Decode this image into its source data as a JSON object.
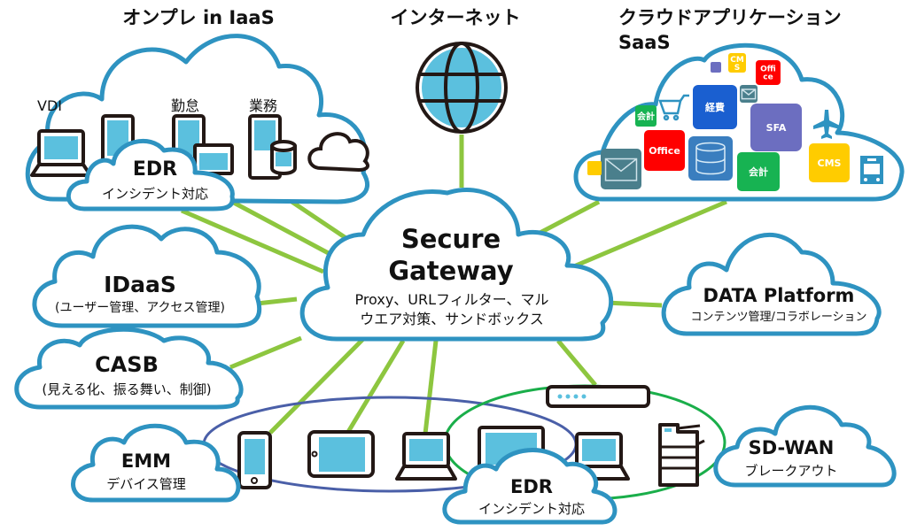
{
  "diagram": {
    "colors": {
      "cloud_stroke": "#2e93c1",
      "link": "#8dc63f",
      "emm_ring": "#4a5fa8",
      "sdwan_ring": "#1aae4a",
      "device_screen": "#5bc0de",
      "device_outline": "#231815"
    },
    "titles": {
      "iaas": "オンプレ in IaaS",
      "internet": "インターネット",
      "saas_line1": "クラウドアプリケーション",
      "saas_line2": "SaaS"
    },
    "iaas": {
      "labels": {
        "vdi": "VDI",
        "kintai": "勤怠",
        "gyomu": "業務"
      },
      "edr": {
        "title": "EDR",
        "subtitle": "インシデント対応"
      }
    },
    "saas": {
      "apps": [
        {
          "label": "",
          "color": "#6c6ec0"
        },
        {
          "label": "CM\nS",
          "line1": "CM",
          "line2": "S",
          "color": "#ffcc00"
        },
        {
          "label": "Office",
          "line1": "Offi",
          "line2": "ce",
          "color": "#ff0000"
        },
        {
          "label": "経費",
          "color": "#1a5fd0"
        },
        {
          "label": "mail",
          "color": "#4a7f8c"
        },
        {
          "label": "会計",
          "color": "#17b352"
        },
        {
          "label": "SFA",
          "color": "#6c6ec0"
        },
        {
          "label": "Office",
          "color": "#ff0000"
        },
        {
          "label": "database",
          "color": "#3a7ebf"
        },
        {
          "label": "会計",
          "color": "#17b352"
        },
        {
          "label": "CMS",
          "color": "#ffcc00"
        },
        {
          "label": "mail",
          "color": "#4a7f8c"
        },
        {
          "label": "",
          "color": "#ffcc00"
        }
      ]
    },
    "gateway": {
      "title_line1": "Secure",
      "title_line2": "Gateway",
      "sub_line1": "Proxy、URLフィルター、マル",
      "sub_line2": "ウエア対策、サンドボックス"
    },
    "idaas": {
      "title": "IDaaS",
      "subtitle": "(ユーザー管理、アクセス管理)"
    },
    "casb": {
      "title": "CASB",
      "subtitle": "(見える化、振る舞い、制御)"
    },
    "data_platform": {
      "title": "DATA Platform",
      "subtitle": "コンテンツ管理/コラボレーション"
    },
    "emm": {
      "title": "EMM",
      "subtitle": "デバイス管理"
    },
    "edr_bottom": {
      "title": "EDR",
      "subtitle": "インシデント対応"
    },
    "sdwan": {
      "title": "SD-WAN",
      "subtitle": "ブレークアウト"
    }
  }
}
